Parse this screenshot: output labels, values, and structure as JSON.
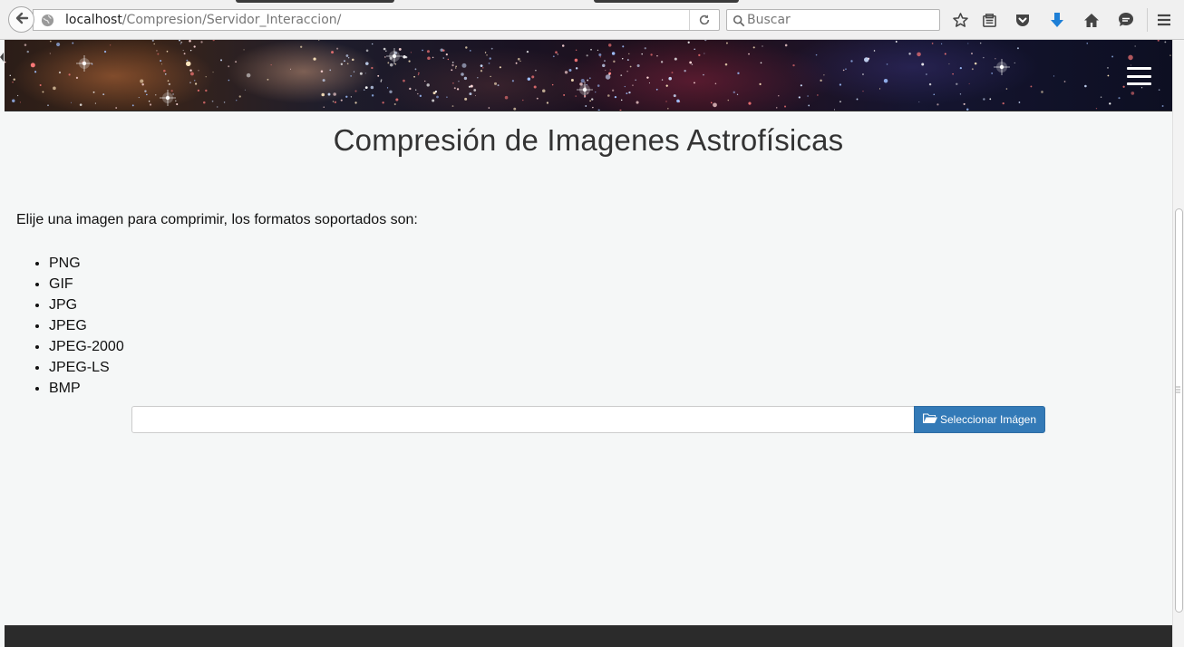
{
  "browser": {
    "url_host": "localhost",
    "url_path": "/Compresion/Servidor_Interaccion/",
    "search_placeholder": "Buscar"
  },
  "page": {
    "title": "Compresión de Imagenes Astrofísicas",
    "intro": "Elije una imagen para comprimir, los formatos soportados son:",
    "formats": [
      "PNG",
      "GIF",
      "JPG",
      "JPEG",
      "JPEG-2000",
      "JPEG-LS",
      "BMP"
    ],
    "file_input_value": "",
    "select_button_label": "Seleccionar Imágen"
  },
  "colors": {
    "primary_button": "#337ab7",
    "footer": "#2b2b2b",
    "page_background": "#f5f7f7"
  },
  "icons": [
    "back-arrow-icon",
    "globe-icon",
    "reload-icon",
    "search-icon",
    "bookmark-star-icon",
    "reading-list-icon",
    "pocket-icon",
    "download-icon",
    "home-icon",
    "chat-icon",
    "menu-icon",
    "hamburger-menu-icon",
    "folder-open-icon"
  ]
}
